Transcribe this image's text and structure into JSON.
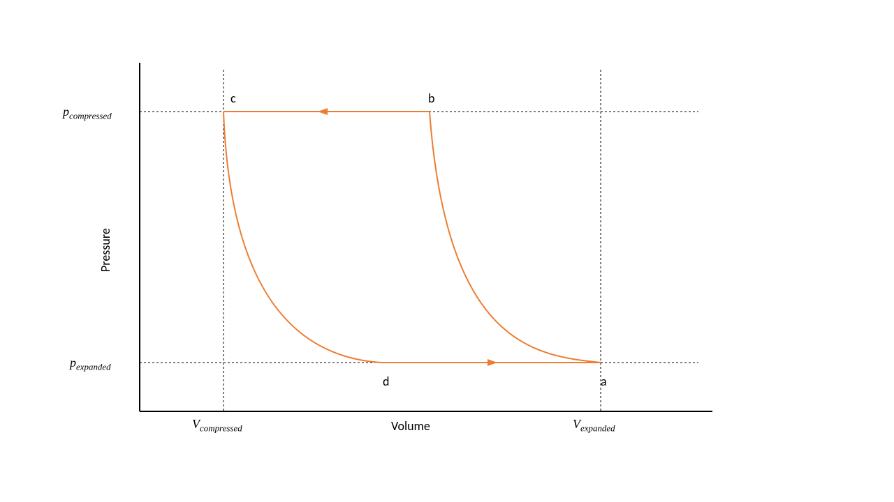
{
  "chart_data": {
    "type": "line",
    "title": "",
    "xlabel": "Volume",
    "ylabel": "Pressure",
    "x_ticks": [
      "V_compressed",
      "V_expanded"
    ],
    "y_ticks": [
      "p_expanded",
      "p_compressed"
    ],
    "points": [
      {
        "name": "a",
        "V": "V_expanded",
        "p": "p_expanded"
      },
      {
        "name": "b",
        "V": "V_intermediate_high",
        "p": "p_compressed"
      },
      {
        "name": "c",
        "V": "V_compressed",
        "p": "p_compressed"
      },
      {
        "name": "d",
        "V": "V_intermediate_low",
        "p": "p_expanded"
      }
    ],
    "segments": [
      {
        "from": "a",
        "to": "b",
        "kind": "adiabatic_compression_curve"
      },
      {
        "from": "b",
        "to": "c",
        "kind": "isobaric_left_arrow"
      },
      {
        "from": "c",
        "to": "d",
        "kind": "adiabatic_expansion_curve"
      },
      {
        "from": "d",
        "to": "a",
        "kind": "isobaric_right_arrow"
      }
    ],
    "cycle_direction": "counterclockwise (as drawn)",
    "color": "#ED7D31"
  },
  "labels": {
    "x_axis": "Volume",
    "y_axis": "Pressure",
    "p_compressed_main": "p",
    "p_compressed_sub": "compressed",
    "p_expanded_main": "p",
    "p_expanded_sub": "expanded",
    "v_compressed_main": "V",
    "v_compressed_sub": "compressed",
    "v_expanded_main": "V",
    "v_expanded_sub": "expanded",
    "pt_a": "a",
    "pt_b": "b",
    "pt_c": "c",
    "pt_d": "d"
  }
}
